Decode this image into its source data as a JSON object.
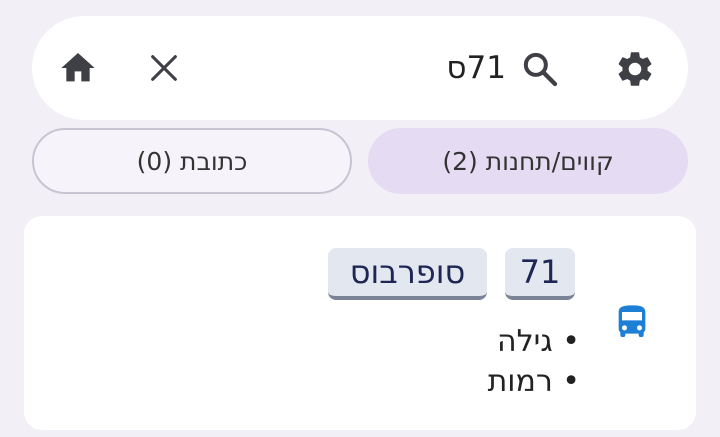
{
  "search": {
    "value": "71ס",
    "placeholder": ""
  },
  "tabs": [
    {
      "label": "קווים/תחנות (2)",
      "active": true
    },
    {
      "label": "כתובת (0)",
      "active": false
    }
  ],
  "result": {
    "route_number": "71",
    "operator": "סופרבוס",
    "destinations": [
      "גילה",
      "רמות"
    ],
    "icon": "bus-icon"
  },
  "colors": {
    "background": "#f2eff7",
    "active_tab": "#e5dcf3",
    "bus_icon": "#1e7fd6",
    "chip_text": "#1d2654",
    "icon_dark": "#3f3f46"
  }
}
